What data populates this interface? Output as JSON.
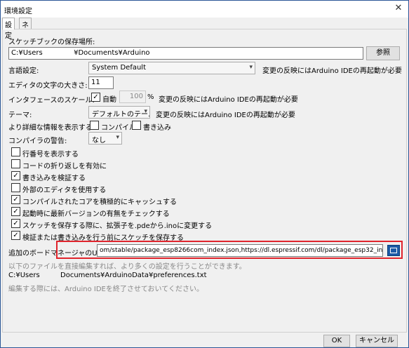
{
  "window": {
    "title": "環境設定",
    "close_glyph": "✕"
  },
  "tabs": [
    {
      "label": "設定"
    },
    {
      "label": "ネットワーク"
    }
  ],
  "sketchbook": {
    "label": "スケッチブックの保存場所:",
    "path_start": "C:¥Users",
    "path_end": "¥Documents¥Arduino",
    "browse_button": "参照"
  },
  "language": {
    "label": "言語設定:",
    "value": "System Default",
    "note": "変更の反映にはArduino IDEの再起動が必要"
  },
  "editor_font": {
    "label": "エディタの文字の大きさ:",
    "value": "11"
  },
  "interface_scale": {
    "label": "インタフェースのスケール:",
    "auto_label": "自動",
    "auto_checked": true,
    "percent_value": "100",
    "percent_unit": "%",
    "note": "変更の反映にはArduino IDEの再起動が必要"
  },
  "theme": {
    "label": "テーマ:",
    "value": "デフォルトのテー...",
    "note": "変更の反映にはArduino IDEの再起動が必要"
  },
  "verbose": {
    "label": "より詳細な情報を表示する:",
    "compile_label": "コンパイル",
    "upload_label": "書き込み",
    "compile_checked": false,
    "upload_checked": false
  },
  "compiler_warnings": {
    "label": "コンパイラの警告:",
    "value": "なし"
  },
  "options": [
    {
      "label": "行番号を表示する",
      "checked": false
    },
    {
      "label": "コードの折り返しを有効に",
      "checked": false
    },
    {
      "label": "書き込みを検証する",
      "checked": true
    },
    {
      "label": "外部のエディタを使用する",
      "checked": false
    },
    {
      "label": "コンパイルされたコアを積極的にキャッシュする",
      "checked": true
    },
    {
      "label": "起動時に最新バージョンの有無をチェックする",
      "checked": true
    },
    {
      "label": "スケッチを保存する際に、拡張子を.pdeから.inoに変更する",
      "checked": true
    },
    {
      "label": "検証または書き込みを行う前にスケッチを保存する",
      "checked": true
    }
  ],
  "board_manager": {
    "label": "追加のボードマネージャのURL:",
    "value": "om/stable/package_esp8266com_index.json,https://dl.espressif.com/dl/package_esp32_index.json"
  },
  "file_info": {
    "edit_hint": "以下のファイルを直接編集すれば、より多くの設定を行うことができます。",
    "path_start": "C:¥Users",
    "path_end": "Documents¥ArduinoData¥preferences.txt",
    "close_hint": "編集する際には、Arduino IDEを終了させておいてください。"
  },
  "footer": {
    "ok": "OK",
    "cancel": "キャンセル"
  },
  "colors": {
    "highlight": "#e0242c",
    "accent": "#1c5aa6"
  },
  "icons": {
    "checkmark": "✓",
    "dropdown": "▾",
    "close": "✕"
  }
}
